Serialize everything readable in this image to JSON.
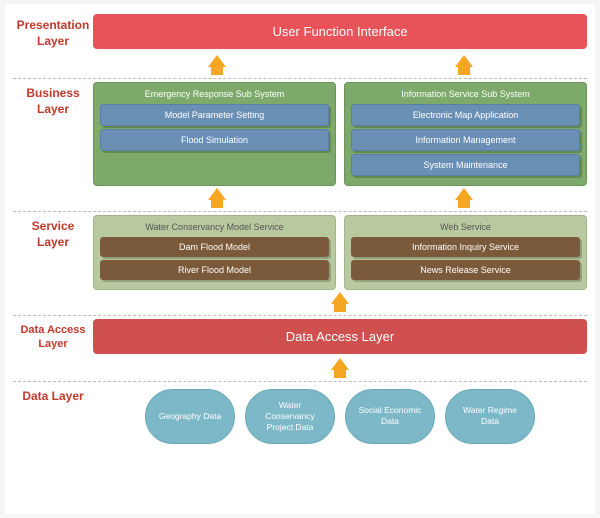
{
  "layers": {
    "presentation": {
      "label": "Presentation\nLayer",
      "content": "User Function Interface"
    },
    "business": {
      "label": "Business Layer",
      "subsystems": [
        {
          "title": "Emergency Response Sub System",
          "modules": [
            "Model Parameter Setting",
            "Flood Simulation"
          ]
        },
        {
          "title": "Information Service Sub System",
          "modules": [
            "Electronic Map Application",
            "Information Management",
            "System Maintenance"
          ]
        }
      ]
    },
    "service": {
      "label": "Service Layer",
      "services": [
        {
          "title": "Water Conservancy Model Service",
          "modules": [
            "Dam Flood Model",
            "River Flood Model"
          ]
        },
        {
          "title": "Web Service",
          "modules": [
            "Information Inquiry Service",
            "News Release Service"
          ]
        }
      ]
    },
    "dataaccess": {
      "label": "Data Access\nLayer",
      "content": "Data Access Layer"
    },
    "data": {
      "label": "Data Layer",
      "cylinders": [
        "Geography Data",
        "Water Conservancy Project Data",
        "Social Economic Data",
        "Water Regime Data"
      ]
    }
  }
}
